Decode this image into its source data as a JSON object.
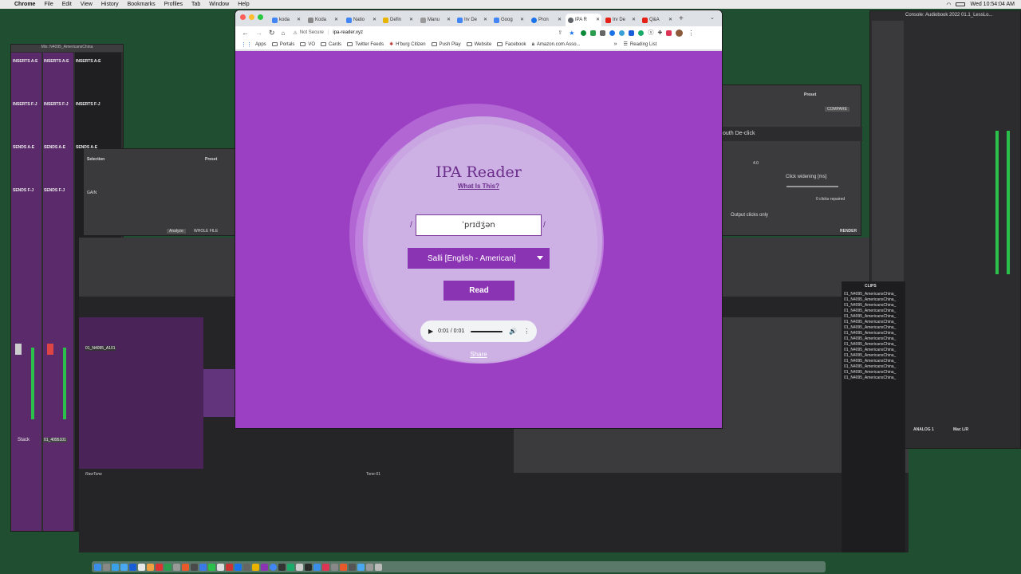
{
  "menubar": {
    "app": "Chrome",
    "items": [
      "File",
      "Edit",
      "View",
      "History",
      "Bookmarks",
      "Profiles",
      "Tab",
      "Window",
      "Help"
    ],
    "clock": "Wed 10:54:04 AM"
  },
  "desktop": {
    "left_window_title": "Mix: N4095_AmericansChina",
    "right_window_title": "Console: Audiobook 2022 01.1_LessLo...",
    "strip_labels": [
      "INSERTS A-E",
      "INSERTS A-E",
      "INSERTS A-E",
      "INSERTS F-J",
      "INSERTS F-J",
      "INSERTS F-J",
      "SENDS A-E",
      "SENDS A-E",
      "SENDS A-E",
      "SENDS F-J",
      "SENDS F-J"
    ],
    "edit_track_name": "01_N4095_A101",
    "stack_label": "Stack",
    "track_name_bottom": "01_4095101",
    "clips_header": "CLIPS",
    "clip_name": "01_N4095_AmericansChina_",
    "raw_tone": "RawTone",
    "tone_label": "Tone-01",
    "plugin_selection": "Selection",
    "plugin_preset": "Preset",
    "plugin_gain": "GAIN",
    "plugin_analyze": "Analyze",
    "plugin_whole_file": "WHOLE FILE",
    "declick_title": "outh De-click",
    "declick_clickwidening": "Click widening [ms]",
    "declick_repaired": "0 clicks repaired",
    "declick_output": "Output clicks only",
    "declick_render": "RENDER",
    "declick_compare": "COMPARE",
    "declick_value": "4.0",
    "analog_label": "ANALOG 1",
    "maclr_label": "Mac L/R"
  },
  "chrome": {
    "tabs": [
      {
        "label": "koda",
        "color": "#4285f4"
      },
      {
        "label": "Koda",
        "color": "#888"
      },
      {
        "label": "Natio",
        "color": "#4285f4"
      },
      {
        "label": "Defin",
        "color": "#e8b400"
      },
      {
        "label": "Manu",
        "color": "#999"
      },
      {
        "label": "Irv De",
        "color": "#4285f4"
      },
      {
        "label": "Goog",
        "color": "#4285f4"
      },
      {
        "label": "Pron",
        "color": "#1a73e8"
      },
      {
        "label": "IPA R",
        "color": "#5f6368"
      },
      {
        "label": "Irv De",
        "color": "#e62117"
      },
      {
        "label": "Q&A",
        "color": "#e62117"
      }
    ],
    "not_secure": "Not Secure",
    "url": "ipa-reader.xyz",
    "bookmarks": [
      "Apps",
      "Portals",
      "VO",
      "Cards",
      "Twitter Feeds",
      "H'burg Citizen",
      "Push Play",
      "Website",
      "Facebook",
      "Amazon.com Asso..."
    ],
    "reading_list": "Reading List"
  },
  "ipa": {
    "title": "IPA Reader",
    "what_is_this": "What Is This?",
    "slash_left": "/",
    "slash_right": "/",
    "input_value": "ˈprɪd͡ʒən",
    "voice": "Salli [English - American]",
    "read_button": "Read",
    "audio_time": "0:01 / 0:01",
    "share": "Share"
  },
  "colors": {
    "page_bg": "#9b3fc3",
    "accent": "#8a33b3",
    "title": "#6a2d8a"
  }
}
